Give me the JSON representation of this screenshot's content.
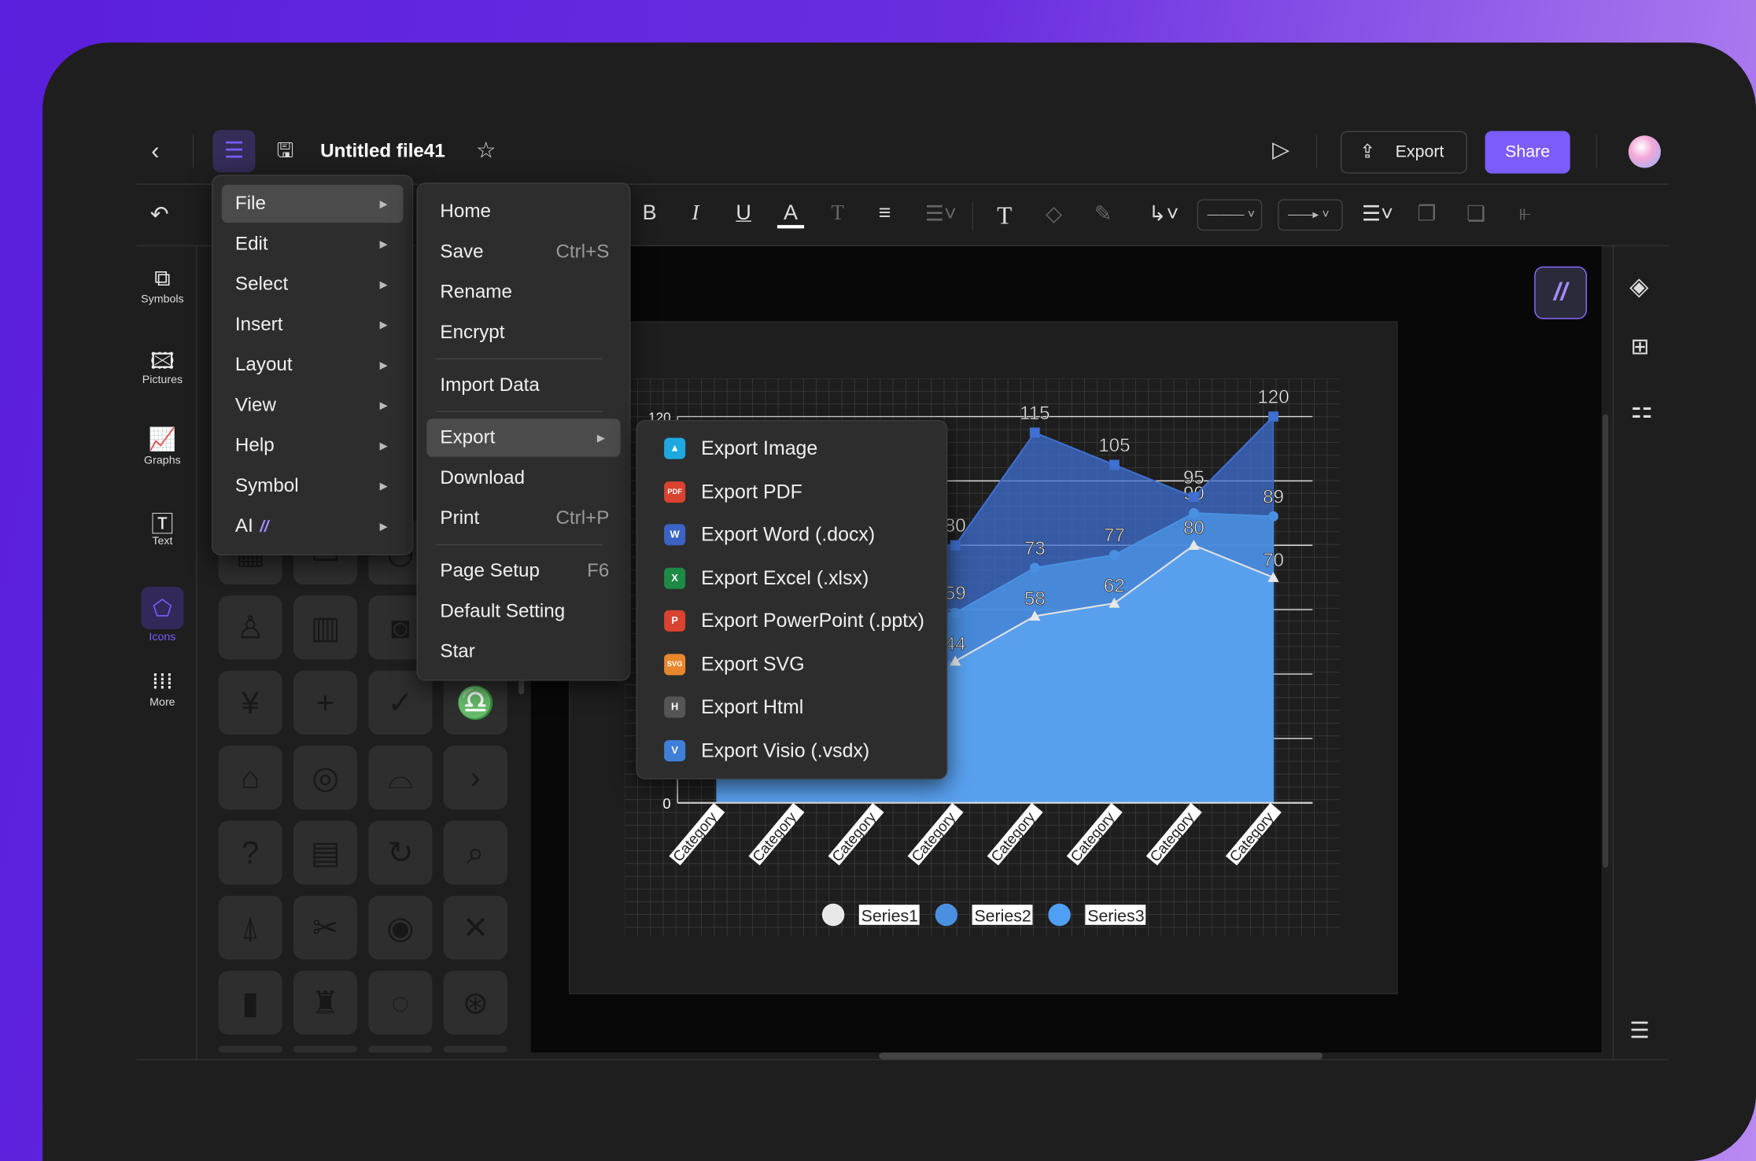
{
  "header": {
    "title": "Untitled file41",
    "export_label": "Export",
    "share_label": "Share"
  },
  "sidebar": {
    "items": [
      {
        "label": "Symbols",
        "icon": "symbols-icon"
      },
      {
        "label": "Pictures",
        "icon": "pictures-icon"
      },
      {
        "label": "Graphs",
        "icon": "graphs-icon"
      },
      {
        "label": "Text",
        "icon": "text-icon"
      },
      {
        "label": "Icons",
        "icon": "icons-icon",
        "active": true
      },
      {
        "label": "More",
        "icon": "more-icon"
      }
    ]
  },
  "toolbar": {
    "bold": "B",
    "italic": "I",
    "underline": "U",
    "font_color": "A",
    "text_style": "T",
    "text": "T"
  },
  "main_menu": {
    "items": [
      {
        "label": "File"
      },
      {
        "label": "Edit"
      },
      {
        "label": "Select"
      },
      {
        "label": "Insert"
      },
      {
        "label": "Layout"
      },
      {
        "label": "View"
      },
      {
        "label": "Help"
      },
      {
        "label": "Symbol"
      },
      {
        "label": "AI"
      }
    ]
  },
  "file_menu": {
    "items": [
      {
        "label": "Home"
      },
      {
        "label": "Save",
        "shortcut": "Ctrl+S"
      },
      {
        "label": "Rename"
      },
      {
        "label": "Encrypt"
      },
      {
        "label": "Import Data"
      },
      {
        "label": "Export"
      },
      {
        "label": "Download"
      },
      {
        "label": "Print",
        "shortcut": "Ctrl+P"
      },
      {
        "label": "Page Setup",
        "shortcut": "F6"
      },
      {
        "label": "Default Setting"
      },
      {
        "label": "Star"
      }
    ]
  },
  "export_menu": {
    "items": [
      {
        "label": "Export Image",
        "badge": "▲",
        "color": "#1fa8e0"
      },
      {
        "label": "Export PDF",
        "badge": "PDF",
        "color": "#d9432f"
      },
      {
        "label": "Export Word (.docx)",
        "badge": "W",
        "color": "#3b63c4"
      },
      {
        "label": "Export Excel (.xlsx)",
        "badge": "X",
        "color": "#1d8a45"
      },
      {
        "label": "Export PowerPoint (.pptx)",
        "badge": "P",
        "color": "#d9432f"
      },
      {
        "label": "Export SVG",
        "badge": "SVG",
        "color": "#e8872e"
      },
      {
        "label": "Export Html",
        "badge": "H",
        "color": "#555555"
      },
      {
        "label": "Export Visio (.vsdx)",
        "badge": "V",
        "color": "#3f7fd8"
      }
    ]
  },
  "colors": {
    "accent": "#7b5cff",
    "share": "#7c5cfa"
  },
  "chart_data": {
    "type": "area",
    "categories": [
      "Category",
      "Category",
      "Category",
      "Category",
      "Category",
      "Category",
      "Category",
      "Category"
    ],
    "ylim": [
      0,
      120
    ],
    "yticks_visible": [
      "120",
      "0"
    ],
    "grid": true,
    "legend_placement": "bottom",
    "series": [
      {
        "name": "Series1",
        "values": [
          null,
          null,
          null,
          44,
          58,
          62,
          80,
          70
        ],
        "color": "#e8e8e8",
        "marker": "triangle"
      },
      {
        "name": "Series2",
        "values": [
          null,
          null,
          null,
          59,
          73,
          77,
          90,
          89
        ],
        "color": "#4a90e2",
        "marker": "circle"
      },
      {
        "name": "Series3",
        "values": [
          null,
          null,
          null,
          80,
          115,
          105,
          95,
          120
        ],
        "color": "#3f6fd0",
        "marker": "square"
      }
    ]
  }
}
